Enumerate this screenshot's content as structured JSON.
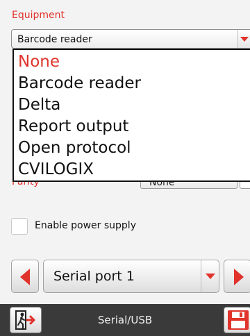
{
  "equipment": {
    "label": "Equipment",
    "selected_value": "Barcode reader",
    "options": [
      "None",
      "Barcode reader",
      "Delta",
      "Report output",
      "Open protocol",
      "CVILOGIX"
    ],
    "highlighted_option": "None"
  },
  "parity": {
    "label": "Parity",
    "value": "None"
  },
  "power_supply": {
    "label": "Enable power supply",
    "checked": false
  },
  "port_selector": {
    "value": "Serial port 1"
  },
  "bottom_bar": {
    "title": "Serial/USB",
    "exit_icon": "exit-door-icon",
    "save_icon": "floppy-save-icon"
  },
  "colors": {
    "accent": "#e0332b",
    "bottom_bar": "#3a3a3a",
    "background": "#f3f3f3"
  }
}
